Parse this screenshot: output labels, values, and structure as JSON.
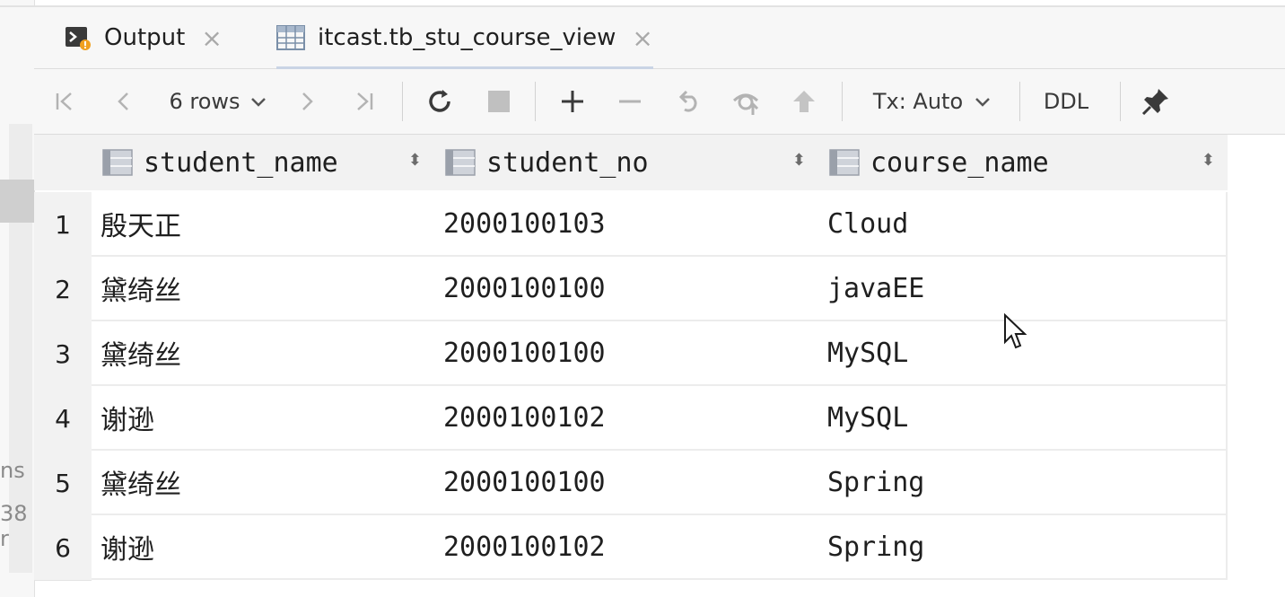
{
  "left_panel": {
    "fragments": [
      "ns",
      "38 r"
    ]
  },
  "tabs": [
    {
      "label": "Output",
      "icon": "console-output-icon",
      "active": false
    },
    {
      "label": "itcast.tb_stu_course_view",
      "icon": "table-view-icon",
      "active": true
    }
  ],
  "toolbar": {
    "rows_label": "6 rows",
    "tx_label": "Tx: Auto",
    "ddl_label": "DDL",
    "icons": [
      "first-page-icon",
      "prev-page-icon",
      "next-page-icon",
      "last-page-icon",
      "refresh-icon",
      "stop-icon",
      "add-row-icon",
      "delete-row-icon",
      "revert-icon",
      "preview-pending-icon",
      "submit-icon",
      "pin-icon"
    ]
  },
  "grid": {
    "columns": [
      {
        "name": "student_name"
      },
      {
        "name": "student_no"
      },
      {
        "name": "course_name"
      }
    ],
    "rows": [
      {
        "num": "1",
        "cells": [
          "殷天正",
          "2000100103",
          "Cloud"
        ]
      },
      {
        "num": "2",
        "cells": [
          "黛绮丝",
          "2000100100",
          "javaEE"
        ]
      },
      {
        "num": "3",
        "cells": [
          "黛绮丝",
          "2000100100",
          "MySQL"
        ]
      },
      {
        "num": "4",
        "cells": [
          "谢逊",
          "2000100102",
          "MySQL"
        ]
      },
      {
        "num": "5",
        "cells": [
          "黛绮丝",
          "2000100100",
          "Spring"
        ]
      },
      {
        "num": "6",
        "cells": [
          "谢逊",
          "2000100102",
          "Spring"
        ]
      }
    ]
  }
}
